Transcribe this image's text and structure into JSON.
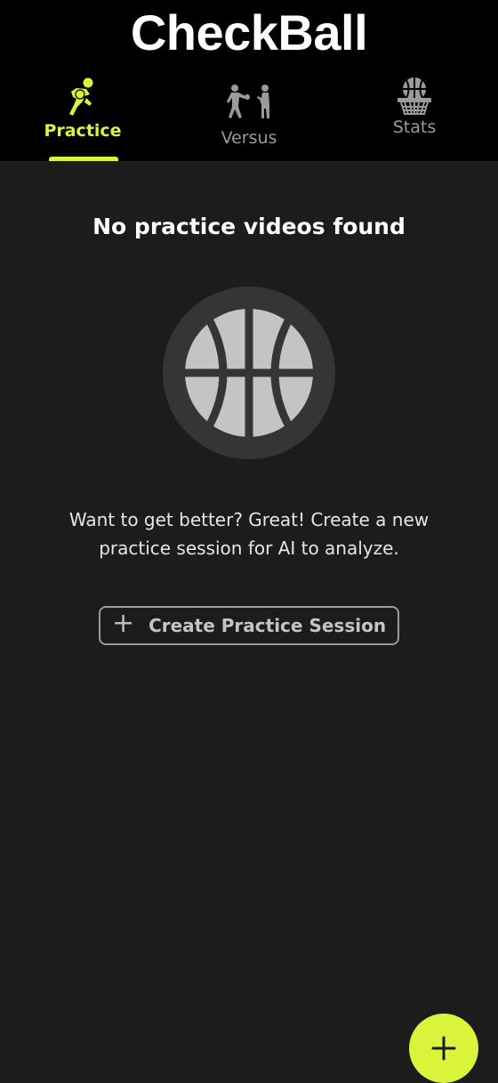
{
  "app": {
    "title": "CheckBall"
  },
  "tabs": [
    {
      "label": "Practice",
      "icon": "basketball-player-icon",
      "active": true
    },
    {
      "label": "Versus",
      "icon": "one-vs-one-icon",
      "active": false
    },
    {
      "label": "Stats",
      "icon": "basketball-hoop-icon",
      "active": false
    }
  ],
  "empty_state": {
    "title": "No practice videos found",
    "icon": "basketball-icon",
    "description": "Want to get better? Great! Create a new practice session for AI to analyze.",
    "button_label": "Create Practice Session",
    "button_icon": "plus-icon"
  },
  "fab": {
    "icon": "plus-icon"
  },
  "colors": {
    "accent": "#d9f43a",
    "header_bg": "#000000",
    "page_bg": "#1c1c1c",
    "inactive_tab": "#9a9a9a"
  }
}
